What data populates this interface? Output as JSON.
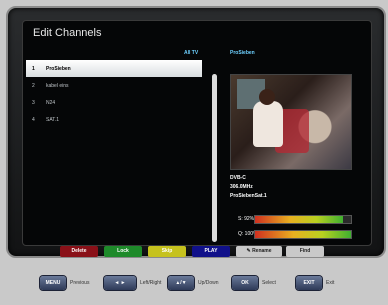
{
  "screen": {
    "title": "Edit Channels",
    "filter_label": "All TV",
    "preview_channel": "ProSieben"
  },
  "channels": [
    {
      "num": "1",
      "name": "ProSieben",
      "selected": true
    },
    {
      "num": "2",
      "name": "kabel eins",
      "selected": false
    },
    {
      "num": "3",
      "name": "N24",
      "selected": false
    },
    {
      "num": "4",
      "name": "SAT.1",
      "selected": false
    }
  ],
  "info": {
    "type": "DVB-C",
    "frequency": "306.0MHz",
    "network": "ProSiebenSat.1"
  },
  "signal": {
    "strength_label": "S:",
    "strength_value": "92%",
    "strength_fraction": 0.92,
    "quality_label": "Q:",
    "quality_value": "100%",
    "quality_fraction": 1.0
  },
  "function_buttons": {
    "red": "Delete",
    "green": "Lock",
    "yellow": "Skip",
    "blue": "PLAY",
    "rename": "Rename",
    "find": "Find"
  },
  "help_bar": {
    "menu_key": "MENU",
    "menu_text": "Previous",
    "lr_text": "Left/Right",
    "ud_key": "▲/▼",
    "ud_text": "Up/Down",
    "ok_key": "OK",
    "ok_text": "Select",
    "exit_key": "EXIT",
    "exit_text": "Exit"
  },
  "colors": {
    "accent": "#6ed0ff",
    "red": "#8a1018",
    "green": "#1e8a2a",
    "yellow": "#c6c21e",
    "blue": "#10108a"
  }
}
